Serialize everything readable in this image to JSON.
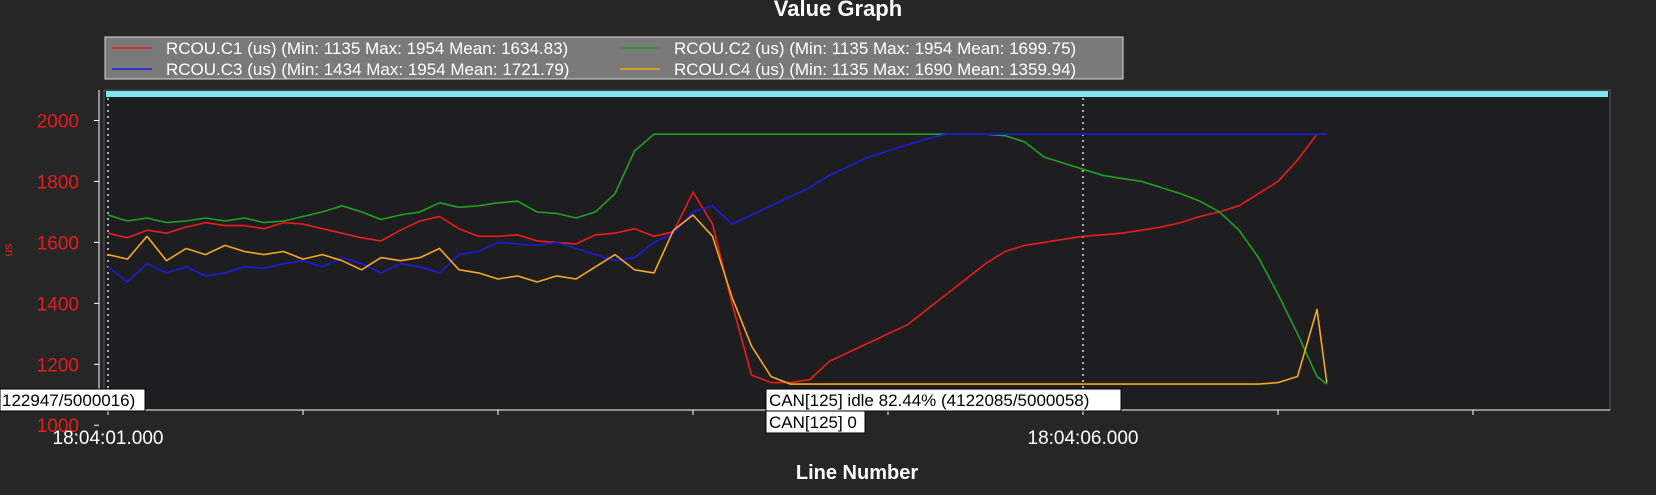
{
  "chart_data": {
    "type": "line",
    "title": "Value Graph",
    "xlabel": "Line Number",
    "ylabel": "us",
    "x_tick_labels": [
      {
        "label": "18:04:01.000",
        "x": 0
      },
      {
        "label": "18:04:06.000",
        "x": 50
      }
    ],
    "x_minor_ticks": [
      10,
      20,
      30,
      40,
      60,
      70,
      80
    ],
    "x_guides": [
      0,
      50
    ],
    "xlim": [
      0,
      77
    ],
    "ylim": [
      1050,
      2100
    ],
    "y_ticks": [
      1000,
      1200,
      1400,
      1600,
      1800,
      2000
    ],
    "legend_position": "top-left",
    "cursor_band_value": 2087,
    "series": [
      {
        "name": "RCOU.C1 (us) (Min: 1135 Max: 1954 Mean: 1634.83)",
        "color": "#e81c1c",
        "x": [
          0,
          1,
          2,
          3,
          4,
          5,
          6,
          7,
          8,
          9,
          10,
          11,
          12,
          13,
          14,
          15,
          16,
          17,
          18,
          19,
          20,
          21,
          22,
          23,
          24,
          25,
          26,
          27,
          28,
          29,
          30,
          31,
          32,
          33,
          34,
          35,
          36,
          37,
          38,
          39,
          40,
          41,
          42,
          43,
          44,
          45,
          46,
          47,
          48,
          49,
          50,
          51,
          52,
          53,
          54,
          55,
          56,
          57,
          58,
          59,
          60,
          61,
          62,
          62.5
        ],
        "values": [
          1630,
          1615,
          1640,
          1630,
          1650,
          1665,
          1655,
          1655,
          1645,
          1665,
          1660,
          1645,
          1630,
          1615,
          1605,
          1640,
          1670,
          1685,
          1645,
          1620,
          1620,
          1625,
          1605,
          1600,
          1595,
          1625,
          1630,
          1645,
          1620,
          1635,
          1765,
          1660,
          1400,
          1165,
          1140,
          1140,
          1150,
          1210,
          1240,
          1270,
          1300,
          1330,
          1380,
          1430,
          1480,
          1530,
          1570,
          1590,
          1600,
          1610,
          1620,
          1625,
          1630,
          1640,
          1650,
          1665,
          1685,
          1700,
          1720,
          1760,
          1800,
          1870,
          1955,
          1955
        ]
      },
      {
        "name": "RCOU.C2 (us) (Min: 1135 Max: 1954 Mean: 1699.75)",
        "color": "#1fa01f",
        "x": [
          0,
          1,
          2,
          3,
          4,
          5,
          6,
          7,
          8,
          9,
          10,
          11,
          12,
          13,
          14,
          15,
          16,
          17,
          18,
          19,
          20,
          21,
          22,
          23,
          24,
          25,
          26,
          27,
          28,
          29,
          30,
          31,
          32,
          33,
          34,
          35,
          36,
          37,
          38,
          39,
          40,
          41,
          42,
          43,
          44,
          45,
          46,
          47,
          48,
          49,
          50,
          51,
          52,
          53,
          54,
          55,
          56,
          57,
          58,
          59,
          60,
          61,
          62,
          62.5
        ],
        "values": [
          1690,
          1670,
          1680,
          1665,
          1670,
          1680,
          1670,
          1680,
          1665,
          1670,
          1685,
          1700,
          1720,
          1700,
          1675,
          1690,
          1700,
          1730,
          1715,
          1720,
          1730,
          1735,
          1700,
          1695,
          1680,
          1700,
          1760,
          1900,
          1955,
          1955,
          1955,
          1955,
          1955,
          1955,
          1955,
          1955,
          1955,
          1955,
          1955,
          1955,
          1955,
          1955,
          1955,
          1955,
          1955,
          1955,
          1950,
          1930,
          1880,
          1860,
          1840,
          1820,
          1810,
          1800,
          1780,
          1760,
          1735,
          1700,
          1640,
          1550,
          1430,
          1300,
          1160,
          1135
        ]
      },
      {
        "name": "RCOU.C3 (us) (Min: 1434 Max: 1954 Mean: 1721.79)",
        "color": "#1a1adc",
        "x": [
          0,
          1,
          2,
          3,
          4,
          5,
          6,
          7,
          8,
          9,
          10,
          11,
          12,
          13,
          14,
          15,
          16,
          17,
          18,
          19,
          20,
          21,
          22,
          23,
          24,
          25,
          26,
          27,
          28,
          29,
          30,
          31,
          32,
          33,
          34,
          35,
          36,
          37,
          38,
          39,
          40,
          41,
          42,
          43,
          44,
          45,
          46,
          47,
          48,
          49,
          50,
          51,
          52,
          53,
          54,
          55,
          56,
          57,
          58,
          59,
          60,
          61,
          62,
          62.5
        ],
        "values": [
          1520,
          1470,
          1530,
          1500,
          1520,
          1490,
          1500,
          1520,
          1515,
          1530,
          1540,
          1520,
          1550,
          1530,
          1500,
          1530,
          1520,
          1500,
          1560,
          1570,
          1600,
          1595,
          1590,
          1600,
          1580,
          1560,
          1540,
          1550,
          1600,
          1630,
          1700,
          1720,
          1660,
          1690,
          1720,
          1750,
          1780,
          1820,
          1850,
          1880,
          1900,
          1920,
          1940,
          1955,
          1955,
          1955,
          1955,
          1955,
          1955,
          1955,
          1955,
          1955,
          1955,
          1955,
          1955,
          1955,
          1955,
          1955,
          1955,
          1955,
          1955,
          1955,
          1955,
          1955
        ]
      },
      {
        "name": "RCOU.C4 (us) (Min: 1135 Max: 1690 Mean: 1359.94)",
        "color": "#f5a623",
        "x": [
          0,
          1,
          2,
          3,
          4,
          5,
          6,
          7,
          8,
          9,
          10,
          11,
          12,
          13,
          14,
          15,
          16,
          17,
          18,
          19,
          20,
          21,
          22,
          23,
          24,
          25,
          26,
          27,
          28,
          29,
          30,
          31,
          32,
          33,
          34,
          35,
          36,
          37,
          38,
          39,
          40,
          41,
          42,
          43,
          44,
          45,
          46,
          47,
          48,
          49,
          50,
          51,
          52,
          53,
          54,
          55,
          56,
          57,
          58,
          59,
          60,
          61,
          62,
          62.5
        ],
        "values": [
          1560,
          1545,
          1620,
          1540,
          1580,
          1560,
          1590,
          1570,
          1560,
          1570,
          1545,
          1560,
          1540,
          1510,
          1550,
          1540,
          1550,
          1580,
          1510,
          1500,
          1480,
          1490,
          1470,
          1490,
          1480,
          1520,
          1560,
          1510,
          1500,
          1640,
          1690,
          1620,
          1420,
          1260,
          1160,
          1135,
          1135,
          1135,
          1135,
          1135,
          1135,
          1135,
          1135,
          1135,
          1135,
          1135,
          1135,
          1135,
          1135,
          1135,
          1135,
          1135,
          1135,
          1135,
          1135,
          1135,
          1135,
          1135,
          1135,
          1135,
          1140,
          1160,
          1380,
          1140
        ]
      }
    ],
    "annotations": [
      {
        "text": "122947/5000016)",
        "position": "bottom-left"
      },
      {
        "text": "CAN[125] idle 82.44% (4122085/5000058)",
        "position": "bottom-center"
      },
      {
        "text": "CAN[125] 0",
        "position": "bottom-center"
      }
    ]
  }
}
